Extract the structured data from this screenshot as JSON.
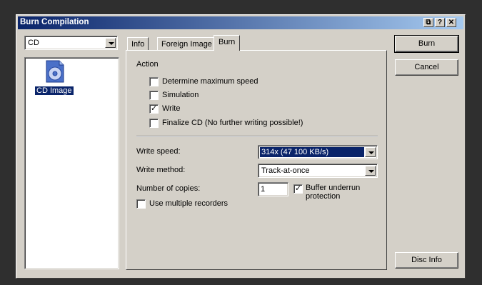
{
  "window": {
    "title": "Burn Compilation"
  },
  "titlebar_buttons": {
    "minimize_label": "⧉",
    "help_label": "?",
    "close_label": "✕"
  },
  "media_select": {
    "value": "CD"
  },
  "file_list": {
    "items": [
      {
        "label": "CD Image",
        "icon": "cd-image-icon"
      }
    ]
  },
  "tabs": [
    {
      "label": "Info"
    },
    {
      "label": "Foreign Image"
    },
    {
      "label": "Burn"
    }
  ],
  "burn_tab": {
    "action_heading": "Action",
    "actions": [
      {
        "label": "Determine maximum speed",
        "checked": false
      },
      {
        "label": "Simulation",
        "checked": false
      },
      {
        "label": "Write",
        "checked": true
      },
      {
        "label": "Finalize CD (No further writing possible!)",
        "checked": false
      }
    ],
    "write_speed": {
      "label": "Write speed:",
      "value": "314x (47 100 KB/s)"
    },
    "write_method": {
      "label": "Write method:",
      "value": "Track-at-once"
    },
    "copies": {
      "label": "Number of copies:",
      "value": "1"
    },
    "buffer_underrun": {
      "label": "Buffer underrun protection",
      "checked": true
    },
    "multiple_recorders": {
      "label": "Use multiple recorders",
      "checked": false
    }
  },
  "buttons": {
    "burn": "Burn",
    "cancel": "Cancel",
    "disc_info": "Disc Info"
  },
  "colors": {
    "titlebar_start": "#0a246a",
    "titlebar_end": "#a6caf0",
    "selection": "#0a246a",
    "face": "#d4d0c8"
  }
}
